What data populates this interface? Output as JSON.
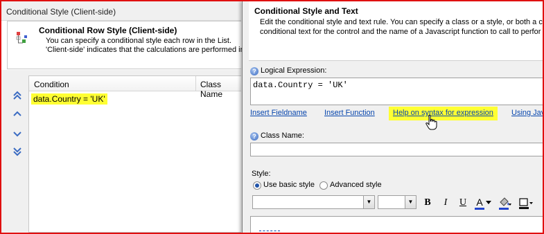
{
  "back_dialog": {
    "title": "Conditional Style (Client-side)",
    "header": {
      "title": "Conditional Row Style (Client-side)",
      "desc_line1": "You can specify a conditional style each row in the List.",
      "desc_line2": "'Client-side' indicates that the calculations are performed in"
    },
    "grid": {
      "columns": [
        "Condition",
        "Class Name"
      ],
      "rows": [
        {
          "condition": "data.Country = 'UK'",
          "class_name": ""
        }
      ]
    },
    "nav_icons": [
      "move-top-icon",
      "move-up-icon",
      "move-down-icon",
      "move-bottom-icon"
    ]
  },
  "front_dialog": {
    "title": "Conditional Style and Text",
    "desc_line1": "Edit the conditional style and text rule. You can specify a class or a style, or both a cl",
    "desc_line2": "conditional text for the control and the name of a Javascript function to call to perfor",
    "logical_expression_label": "Logical Expression:",
    "logical_expression_value": "data.Country = 'UK'",
    "links": {
      "insert_fieldname": "Insert Fieldname",
      "insert_function": "Insert Function",
      "help_syntax": "Help on syntax for expression",
      "using_java": "Using Jav"
    },
    "class_name_label": "Class Name:",
    "class_name_value": "",
    "style_label": "Style:",
    "radio_basic": "Use basic style",
    "radio_advanced": "Advanced style",
    "selected_style_mode": "basic",
    "toolbar": {
      "bold": "B",
      "italic": "I",
      "underline": "U",
      "font_color": "A"
    }
  },
  "colors": {
    "highlight": "#ffff33",
    "frame_red": "#e01010",
    "link_blue": "#0645ad"
  }
}
